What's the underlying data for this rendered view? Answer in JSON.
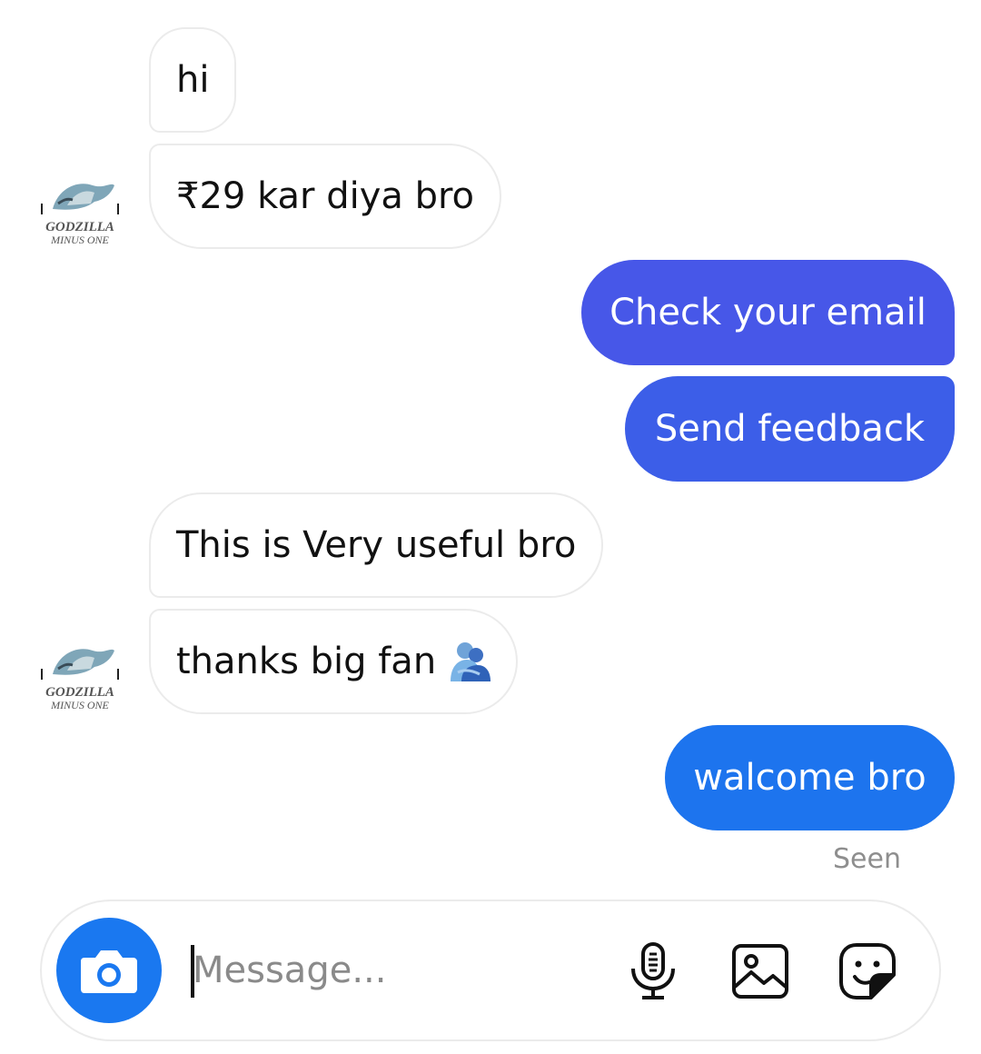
{
  "thread": {
    "messages": [
      {
        "side": "incoming",
        "text": "hi"
      },
      {
        "side": "incoming",
        "text": "₹29 kar diya bro"
      },
      {
        "side": "outgoing",
        "text": "Check your email"
      },
      {
        "side": "outgoing",
        "text": "Send feedback"
      },
      {
        "side": "incoming",
        "text": "This is Very useful bro"
      },
      {
        "side": "incoming",
        "text": "thanks big fan",
        "emoji": "people-hugging-emoji"
      },
      {
        "side": "outgoing",
        "text": "walcome bro"
      }
    ],
    "status": "Seen",
    "avatar_lines": [
      "GODZILLA",
      "MINUS ONE"
    ]
  },
  "composer": {
    "placeholder": "Message...",
    "value": "",
    "icons": [
      "camera-icon",
      "microphone-icon",
      "gallery-icon",
      "sticker-icon"
    ]
  },
  "colors": {
    "outgoing_top": "#4757e8",
    "outgoing_bottom": "#1d74ee",
    "camera_button": "#1a78f0",
    "incoming_border": "#ebebeb",
    "seen_text": "#8e8e8e"
  }
}
